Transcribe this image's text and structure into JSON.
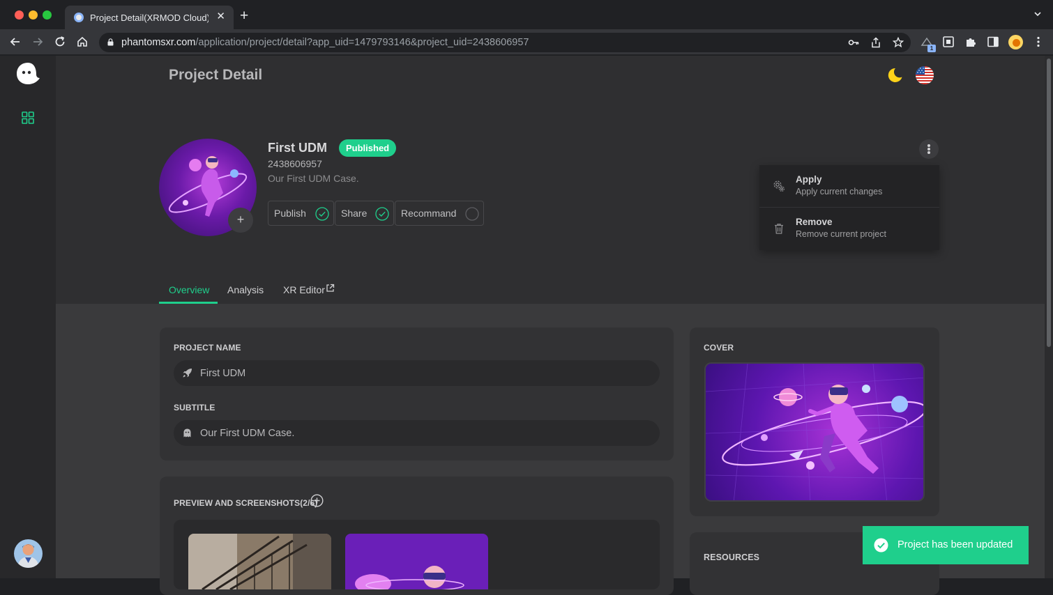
{
  "browser": {
    "tab_title": "Project Detail(XRMOD Cloud) - XRMOD",
    "url_host": "phantomsxr.com",
    "url_path": "/application/project/detail?app_uid=1479793146&project_uid=2438606957",
    "extension_badge": "1"
  },
  "page": {
    "title": "Project Detail"
  },
  "project": {
    "name": "First UDM",
    "status": "Published",
    "uid": "2438606957",
    "subtitle": "Our First UDM Case.",
    "avatar_add": "+",
    "flags": [
      {
        "label": "Publish",
        "checked": true
      },
      {
        "label": "Share",
        "checked": true
      },
      {
        "label": "Recommand",
        "checked": false
      }
    ]
  },
  "menu": {
    "items": [
      {
        "title": "Apply",
        "description": "Apply current changes",
        "icon": "gear-icon"
      },
      {
        "title": "Remove",
        "description": "Remove current project",
        "icon": "trash-icon"
      }
    ]
  },
  "tabs": [
    {
      "label": "Overview",
      "active": true
    },
    {
      "label": "Analysis",
      "active": false
    },
    {
      "label": "XR Editor",
      "active": false
    }
  ],
  "form": {
    "project_name_label": "PROJECT NAME",
    "project_name_value": "First UDM",
    "subtitle_label": "SUBTITLE",
    "subtitle_value": "Our First UDM Case."
  },
  "cover": {
    "label": "COVER"
  },
  "preview": {
    "label": "PREVIEW AND SCREENSHOTS(2/6)"
  },
  "resources": {
    "label": "RESOURCES"
  },
  "toast": {
    "message": "Project has been updated"
  },
  "colors": {
    "accent": "#1fcf8c",
    "background": "#3a3a3c",
    "card": "#323234",
    "sidebar": "#28282a"
  }
}
